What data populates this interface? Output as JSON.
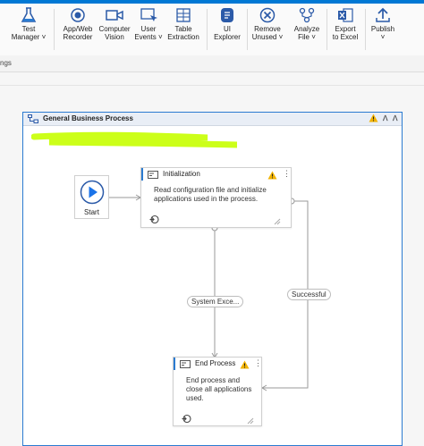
{
  "window_fragment": "",
  "ribbon": {
    "buttons": [
      {
        "key": "test_manager",
        "label1": "Test",
        "label2": "Manager ˅"
      },
      {
        "key": "app_web_recorder",
        "label1": "App/Web",
        "label2": "Recorder"
      },
      {
        "key": "computer_vision",
        "label1": "Computer",
        "label2": "Vision"
      },
      {
        "key": "user_events",
        "label1": "User",
        "label2": "Events ˅"
      },
      {
        "key": "table_extraction",
        "label1": "Table",
        "label2": "Extraction"
      },
      {
        "key": "ui_explorer",
        "label1": "UI",
        "label2": "Explorer"
      },
      {
        "key": "remove_unused",
        "label1": "Remove",
        "label2": "Unused ˅"
      },
      {
        "key": "analyze_file",
        "label1": "Analyze",
        "label2": "File ˅"
      },
      {
        "key": "export_to_excel",
        "label1": "Export",
        "label2": "to Excel"
      },
      {
        "key": "publish",
        "label1": "Publish",
        "label2": "˅"
      }
    ]
  },
  "subbar": {
    "text": "ngs"
  },
  "sequence": {
    "title": "General Business Process",
    "has_warning": true
  },
  "nodes": {
    "start": {
      "label": "Start"
    },
    "initialization": {
      "title": "Initialization",
      "description_line1": "Read configuration file and initialize",
      "description_line2": "applications used in the process."
    },
    "end_process": {
      "title": "End Process",
      "description_line1": "End process and",
      "description_line2": "close all applications",
      "description_line3": "used."
    }
  },
  "edges": {
    "system_exception": "System Exce...",
    "successful": "Successful"
  },
  "colors": {
    "accent": "#2b7bd1",
    "highlight": "#c6ff00",
    "warning": "#f2b300",
    "title_bar": "#0078d4"
  }
}
